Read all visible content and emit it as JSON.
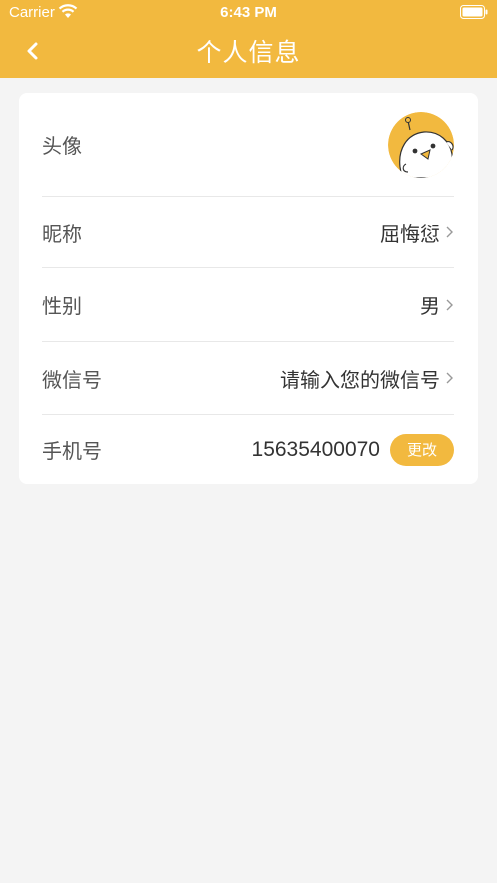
{
  "status_bar": {
    "carrier": "Carrier",
    "time": "6:43 PM"
  },
  "nav": {
    "title": "个人信息",
    "back_icon": "chevron-left-icon"
  },
  "profile": {
    "avatar_label": "头像",
    "nickname_label": "昵称",
    "nickname_value": "屈悔愆",
    "gender_label": "性别",
    "gender_value": "男",
    "wechat_label": "微信号",
    "wechat_placeholder": "请输入您的微信号",
    "phone_label": "手机号",
    "phone_value": "15635400070",
    "change_label": "更改"
  },
  "colors": {
    "accent": "#f2b93f",
    "background": "#f4f4f4",
    "card": "#ffffff"
  }
}
